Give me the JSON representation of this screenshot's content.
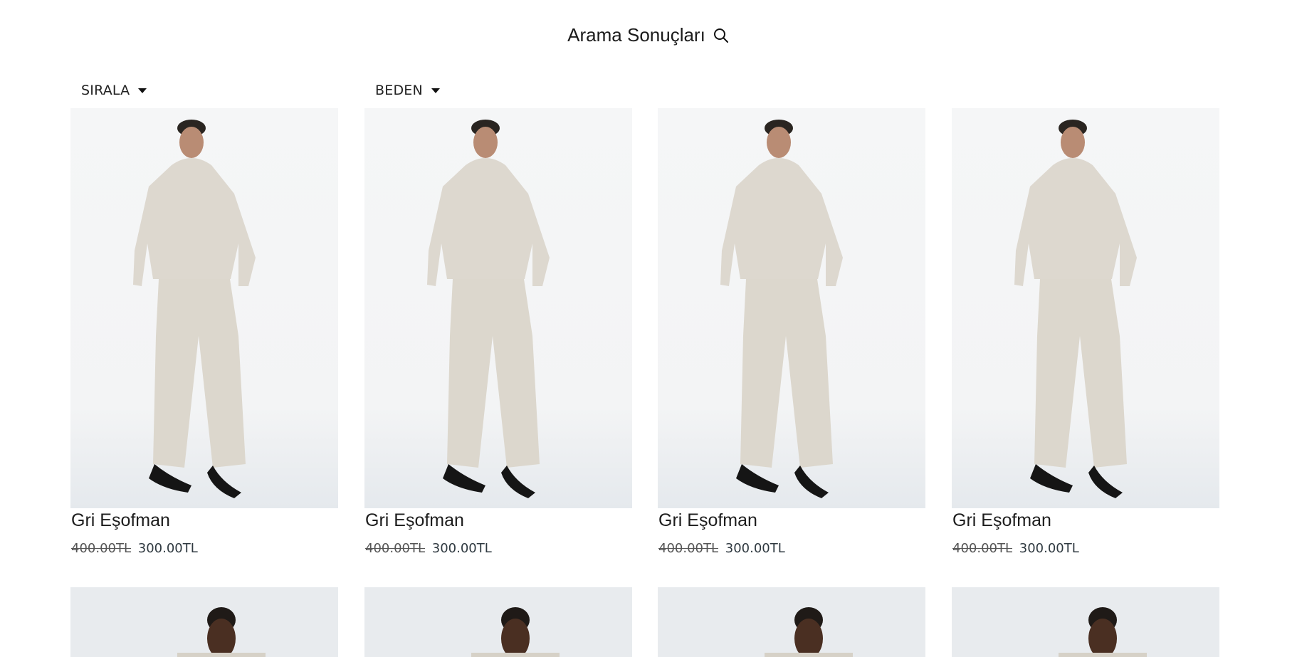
{
  "header": {
    "title": "Arama Sonuçları",
    "search_icon": "search-icon"
  },
  "filters": {
    "sort_label": "SIRALA",
    "size_label": "BEDEN"
  },
  "products": [
    {
      "name": "Gri Eşofman",
      "old_price": "400.00TL",
      "new_price": "300.00TL"
    },
    {
      "name": "Gri Eşofman",
      "old_price": "400.00TL",
      "new_price": "300.00TL"
    },
    {
      "name": "Gri Eşofman",
      "old_price": "400.00TL",
      "new_price": "300.00TL"
    },
    {
      "name": "Gri Eşofman",
      "old_price": "400.00TL",
      "new_price": "300.00TL"
    }
  ],
  "colors": {
    "page_bg": "#ffffff",
    "photo_bg": "#f3f4f5",
    "garment": "#ddd8cf",
    "shoe": "#151515"
  }
}
